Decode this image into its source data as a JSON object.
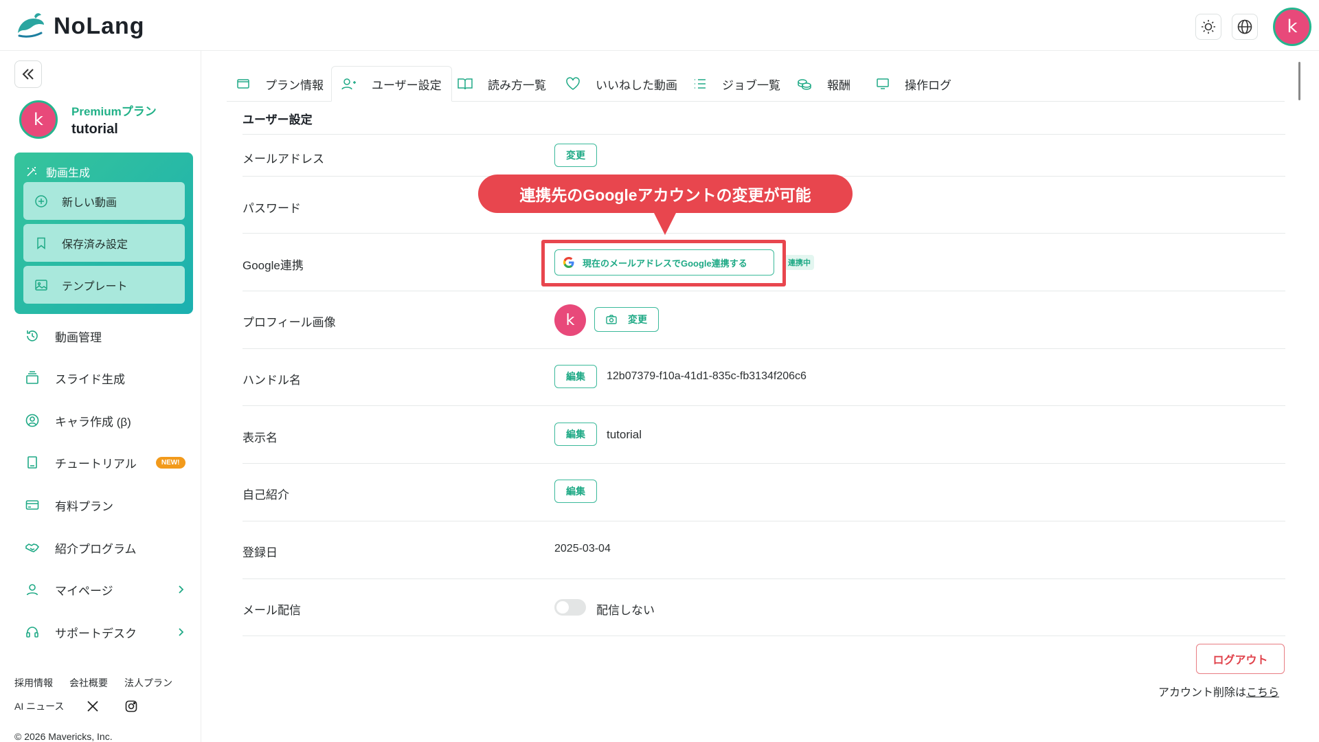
{
  "app": {
    "name": "NoLang"
  },
  "header": {
    "avatar_letter": "k"
  },
  "profile": {
    "plan": "Premiumプラン",
    "username": "tutorial",
    "avatar_letter": "k"
  },
  "video_gen": {
    "title": "動画生成",
    "items": [
      {
        "label": "新しい動画",
        "icon": "plus-circle-icon"
      },
      {
        "label": "保存済み設定",
        "icon": "bookmark-icon"
      },
      {
        "label": "テンプレート",
        "icon": "image-icon"
      }
    ]
  },
  "nav": [
    {
      "label": "動画管理",
      "icon": "history-icon"
    },
    {
      "label": "スライド生成",
      "icon": "slides-icon"
    },
    {
      "label": "キャラ作成 (β)",
      "icon": "character-icon"
    },
    {
      "label": "チュートリアル",
      "icon": "book-icon",
      "badge": "NEW!"
    },
    {
      "label": "有料プラン",
      "icon": "card-icon"
    },
    {
      "label": "紹介プログラム",
      "icon": "handshake-icon"
    },
    {
      "label": "マイページ",
      "icon": "user-icon"
    },
    {
      "label": "サポートデスク",
      "icon": "headset-icon"
    }
  ],
  "footer": {
    "links": [
      "採用情報",
      "会社概要",
      "法人プラン"
    ],
    "ai_news": "AI ニュース",
    "copyright": "© 2026 Mavericks, Inc."
  },
  "tabs": [
    {
      "label": "プラン情報",
      "icon": "wallet-icon"
    },
    {
      "label": "ユーザー設定",
      "icon": "user-settings-icon",
      "active": true
    },
    {
      "label": "読み方一覧",
      "icon": "open-book-icon"
    },
    {
      "label": "いいねした動画",
      "icon": "heart-icon"
    },
    {
      "label": "ジョブ一覧",
      "icon": "list-icon"
    },
    {
      "label": "報酬",
      "icon": "coins-icon"
    },
    {
      "label": "操作ログ",
      "icon": "monitor-icon"
    }
  ],
  "settings": {
    "title": "ユーザー設定",
    "email": {
      "label": "メールアドレス",
      "button": "変更"
    },
    "password": {
      "label": "パスワード"
    },
    "google": {
      "label": "Google連携",
      "button": "現在のメールアドレスでGoogle連携する",
      "status": "連携中"
    },
    "profile_image": {
      "label": "プロフィール画像",
      "button": "変更",
      "avatar_letter": "k"
    },
    "handle": {
      "label": "ハンドル名",
      "button": "編集",
      "value": "12b07379-f10a-41d1-835c-fb3134f206c6"
    },
    "display_name": {
      "label": "表示名",
      "button": "編集",
      "value": "tutorial"
    },
    "bio": {
      "label": "自己紹介",
      "button": "編集"
    },
    "registered": {
      "label": "登録日",
      "value": "2025-03-04"
    },
    "mail_delivery": {
      "label": "メール配信",
      "toggle_label": "配信しない"
    }
  },
  "annotation": {
    "callout": "連携先のGoogleアカウントの変更が可能"
  },
  "account": {
    "logout": "ログアウト",
    "delete_prefix": "アカウント削除は",
    "delete_link": "こちら"
  },
  "colors": {
    "accent": "#22b188",
    "avatar": "#e8497a",
    "callout": "#e8464e",
    "badge": "#f29a1b"
  }
}
